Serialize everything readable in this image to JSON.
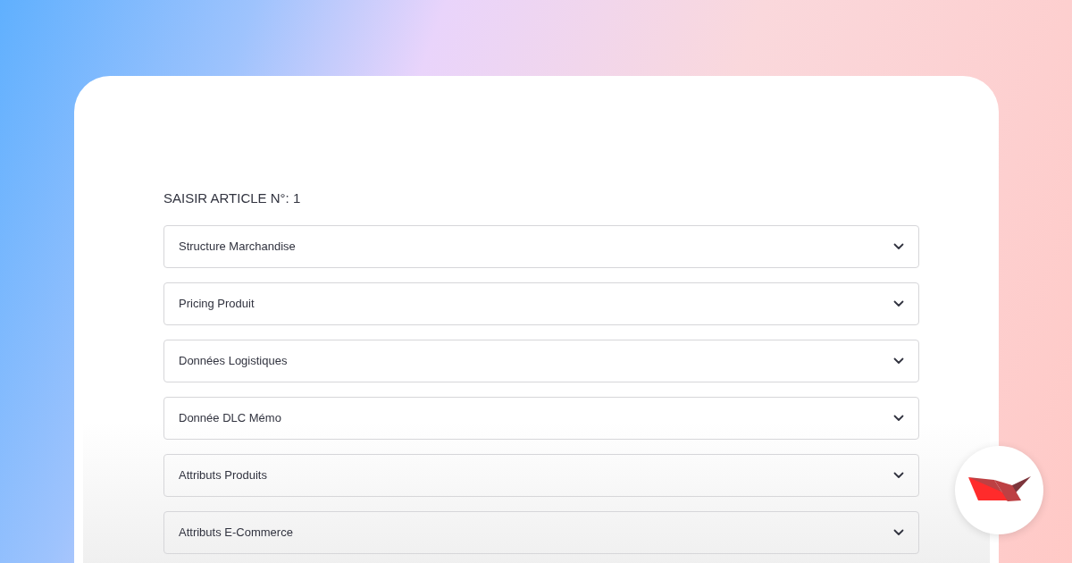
{
  "heading": "SAISIR ARTICLE N°: 1",
  "sections": [
    {
      "label": "Structure Marchandise",
      "expanded": false
    },
    {
      "label": "Pricing Produit",
      "expanded": false
    },
    {
      "label": "Données Logistiques",
      "expanded": false
    },
    {
      "label": "Donnée DLC Mémo",
      "expanded": false
    },
    {
      "label": "Attributs Produits",
      "expanded": false
    },
    {
      "label": "Attributs E-Commerce",
      "expanded": false
    }
  ]
}
